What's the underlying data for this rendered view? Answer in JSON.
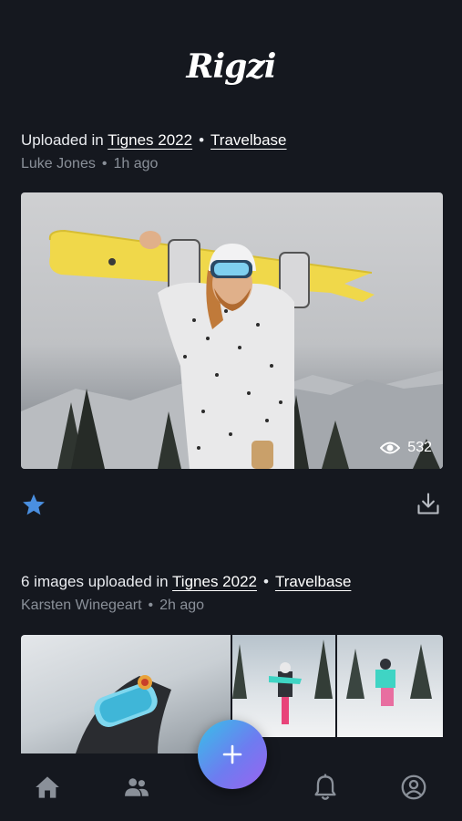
{
  "app": {
    "logo_text": "Rigzi"
  },
  "posts": [
    {
      "prefix": "Uploaded in ",
      "album": "Tignes 2022",
      "separator": "•",
      "group": "Travelbase",
      "author": "Luke Jones",
      "time": "1h ago",
      "views": "532",
      "star_color": "#4a8fe0"
    },
    {
      "prefix": "6 images uploaded in ",
      "album": "Tignes 2022",
      "separator": "•",
      "group": "Travelbase",
      "author": "Karsten Winegeart",
      "time": "2h ago"
    }
  ],
  "tabbar": {
    "icons": [
      "home-icon",
      "people-icon",
      "plus-icon",
      "bell-icon",
      "profile-icon"
    ],
    "fab_gradient": [
      "#36c2e8",
      "#9b63f0"
    ]
  }
}
